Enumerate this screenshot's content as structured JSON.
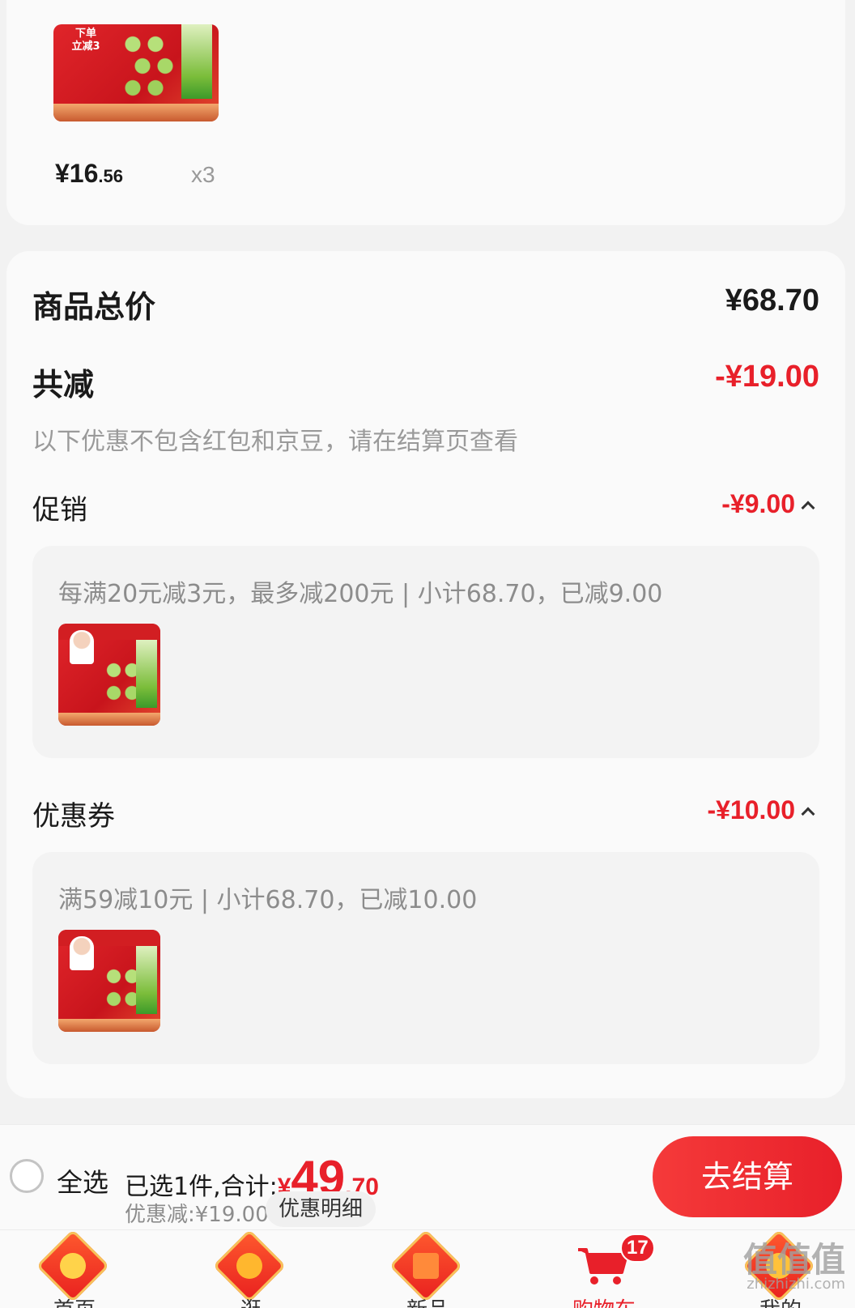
{
  "item": {
    "thumb_tag": "下单\n立减3",
    "price_yen": "¥16",
    "price_cents": ".56",
    "quantity": "x3"
  },
  "summary": {
    "total_label": "商品总价",
    "total_value": "¥68.70",
    "discount_label": "共减",
    "discount_value": "-¥19.00",
    "note": "以下优惠不包含红包和京豆，请在结算页查看",
    "promo": {
      "label": "促销",
      "value": "-¥9.00",
      "detail": "每满20元减3元，最多减200元 | 小计68.70，已减9.00"
    },
    "coupon": {
      "label": "优惠券",
      "value": "-¥10.00",
      "detail": "满59减10元 | 小计68.70，已减10.00"
    }
  },
  "checkout": {
    "select_all_label": "全选",
    "selected_text": "已选1件,合计:",
    "total_yen": "¥",
    "total_int": "49",
    "total_dec": ".70",
    "discount_line": "优惠减:¥19.00",
    "discount_detail_button": "优惠明细",
    "checkout_button": "去结算"
  },
  "tabs": [
    {
      "label": "首页",
      "icon": "home-icon"
    },
    {
      "label": "逛",
      "icon": "browse-icon"
    },
    {
      "label": "新品",
      "icon": "new-products-icon"
    },
    {
      "label": "购物车",
      "icon": "cart-icon",
      "badge": "17",
      "active": true
    },
    {
      "label": "我的",
      "icon": "profile-icon"
    }
  ],
  "watermark": {
    "text": "值值值",
    "sub": "zhizhizhi.com"
  },
  "colors": {
    "accent": "#e8202a",
    "background": "#f2f2f2",
    "card": "#fafafa"
  }
}
